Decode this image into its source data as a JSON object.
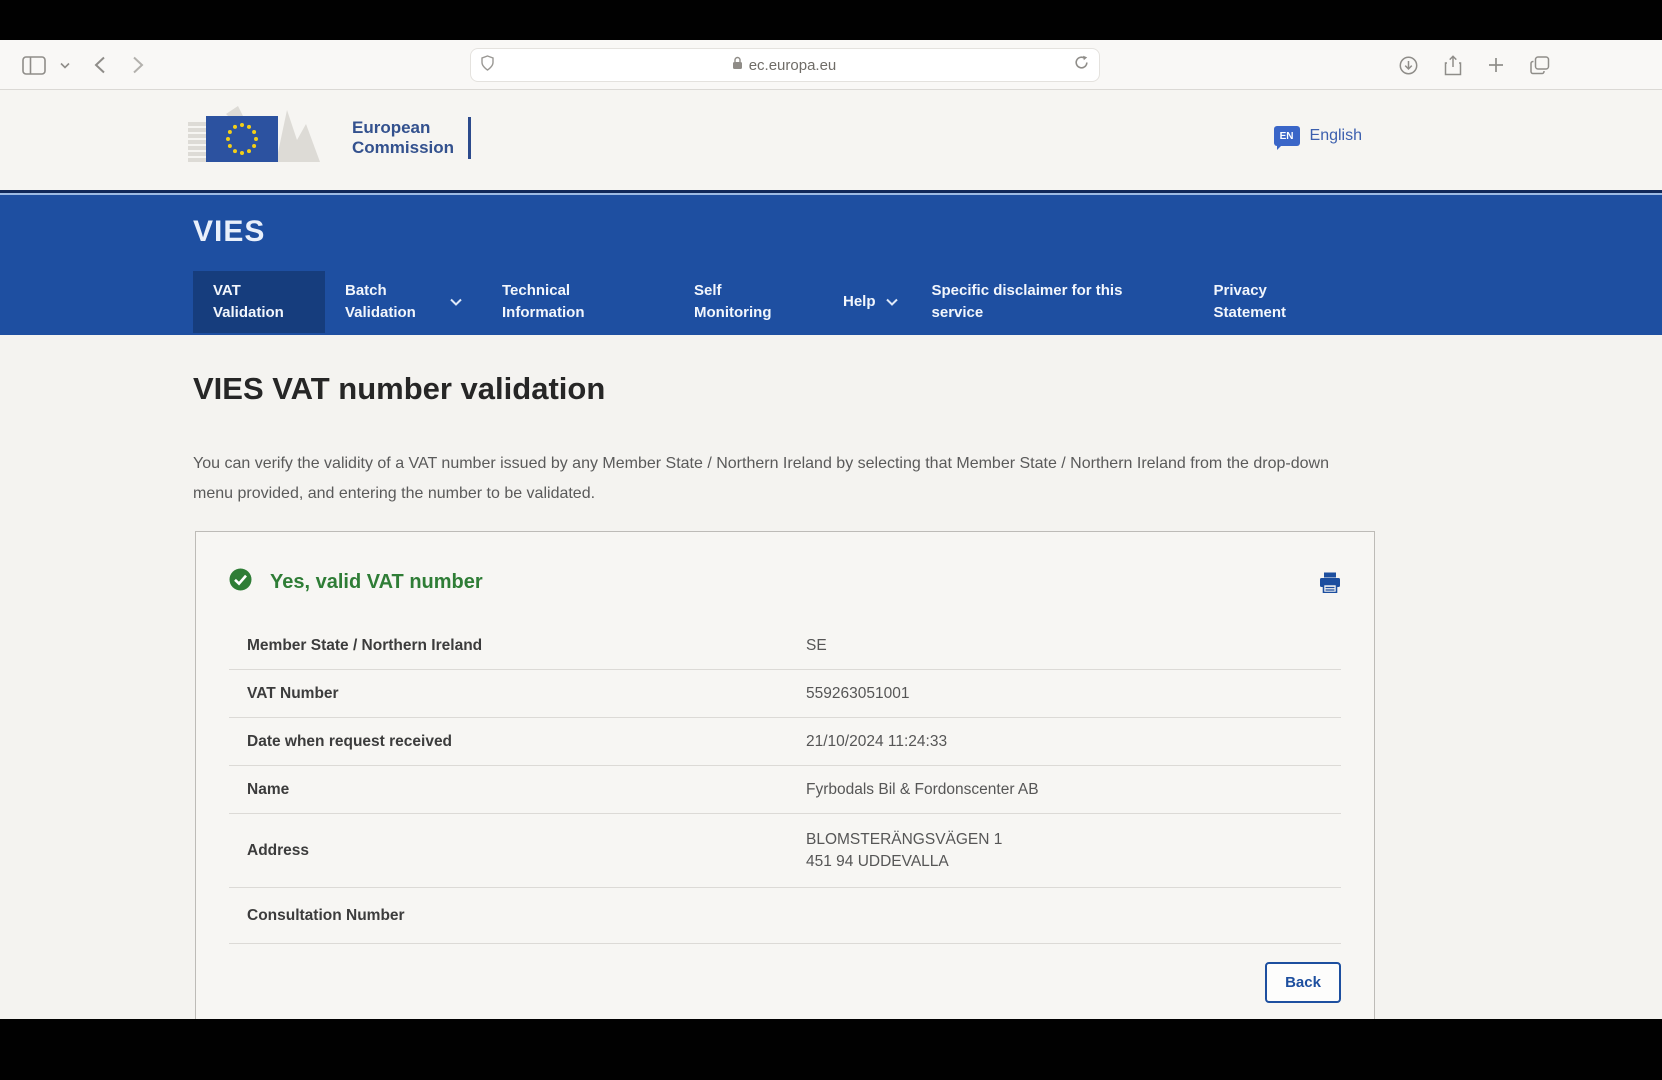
{
  "browser": {
    "address": "ec.europa.eu",
    "icons": [
      "sidebar-icon",
      "chevron-down-icon",
      "back-icon",
      "forward-icon",
      "privacy-shield-icon",
      "lock-icon",
      "reload-icon",
      "downloads-icon",
      "share-icon",
      "new-tab-icon",
      "tabs-icon"
    ]
  },
  "header": {
    "logo_line1": "European",
    "logo_line2": "Commission",
    "lang_badge": "EN",
    "lang_label": "English"
  },
  "nav": {
    "brand": "VIES",
    "items": [
      {
        "label": "VAT Validation",
        "active": true
      },
      {
        "label": "Batch Validation",
        "chevron": true
      },
      {
        "label": "Technical Information"
      },
      {
        "label": "Self Monitoring"
      },
      {
        "label": "Help",
        "chevron": true
      },
      {
        "label": "Specific disclaimer for this service"
      },
      {
        "label": "Privacy Statement"
      }
    ]
  },
  "main": {
    "title": "VIES VAT number validation",
    "intro": "You can verify the validity of a VAT number issued by any Member State / Northern Ireland by selecting that Member State / Northern Ireland from the drop-down menu provided, and entering the number to be validated.",
    "result": {
      "status": "Yes, valid VAT number",
      "rows": [
        {
          "label": "Member State / Northern Ireland",
          "value": "SE"
        },
        {
          "label": "VAT Number",
          "value": "559263051001"
        },
        {
          "label": "Date when request received",
          "value": "21/10/2024 11:24:33"
        },
        {
          "label": "Name",
          "value": "Fyrbodals Bil & Fordonscenter AB"
        },
        {
          "label": "Address",
          "value": "BLOMSTERÄNGSVÄGEN 1",
          "value2": "451 94 UDDEVALLA"
        },
        {
          "label": "Consultation Number",
          "value": ""
        }
      ],
      "back_label": "Back"
    }
  },
  "colors": {
    "band_blue": "#1e4fa1",
    "active_item_blue": "#163d7d",
    "link_blue": "#1d4f9f",
    "success_green": "#2f7d36",
    "page_bg": "#f4f3f0"
  }
}
